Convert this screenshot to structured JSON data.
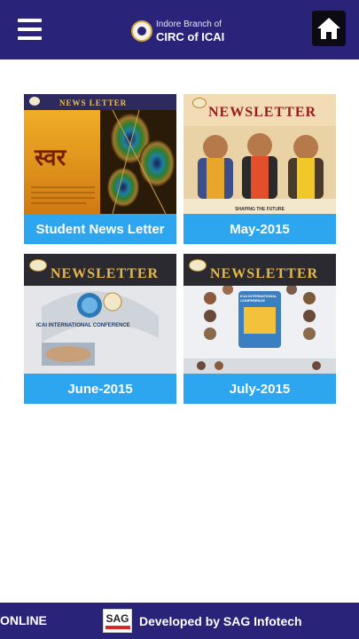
{
  "header": {
    "brand_line1": "Indore Branch of",
    "brand_line2": "CIRC of ICAI",
    "menu_icon": "hamburger-menu-icon",
    "home_icon": "home-icon"
  },
  "newsletters": [
    {
      "label": "Student News Letter",
      "cover_word": "स्वर",
      "cover_title": "NEWS LETTER"
    },
    {
      "label": "May-2015",
      "cover_title": "NEWSLETTER",
      "cover_sub": "SHAPING THE FUTURE"
    },
    {
      "label": "June-2015",
      "cover_title": "NEWSLETTER",
      "cover_sub": "ICAI INTERNATIONAL CONFERENCE"
    },
    {
      "label": "July-2015",
      "cover_title": "NEWSLETTER",
      "cover_sub": "ICAI INTERNATIONAL CONFERENCE"
    }
  ],
  "footer": {
    "online": "ONLINE",
    "sag_logo": "SAG",
    "developed_by": "Developed by SAG Infotech"
  },
  "colors": {
    "header_bg": "#2a237a",
    "caption_bg": "#2da5ef"
  }
}
